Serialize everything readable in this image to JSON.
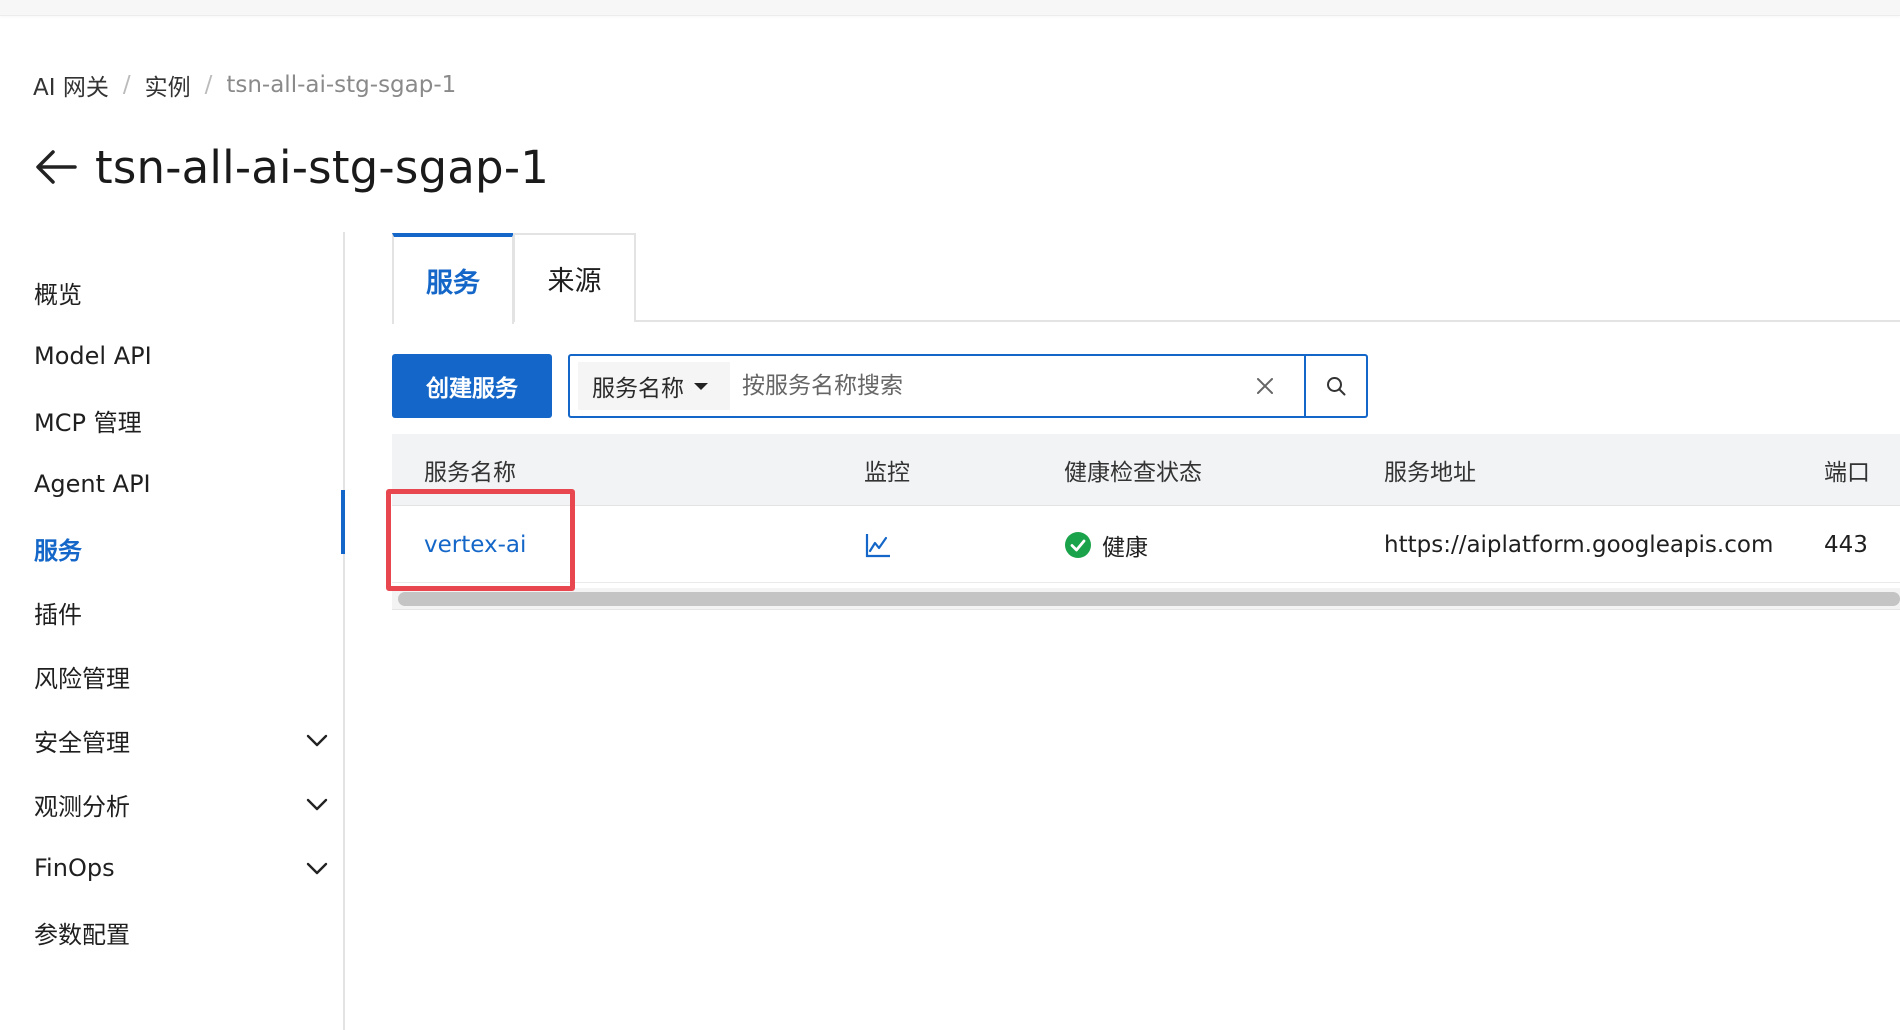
{
  "breadcrumb": [
    "AI 网关",
    "实例",
    "tsn-all-ai-stg-sgap-1"
  ],
  "page_title": "tsn-all-ai-stg-sgap-1",
  "sidebar": {
    "items": [
      {
        "label": "概览"
      },
      {
        "label": "Model API"
      },
      {
        "label": "MCP 管理"
      },
      {
        "label": "Agent API"
      },
      {
        "label": "服务",
        "active": true
      },
      {
        "label": "插件"
      },
      {
        "label": "风险管理"
      },
      {
        "label": "安全管理",
        "expandable": true
      },
      {
        "label": "观测分析",
        "expandable": true
      },
      {
        "label": "FinOps",
        "expandable": true
      },
      {
        "label": "参数配置"
      }
    ]
  },
  "tabs": [
    {
      "label": "服务",
      "active": true
    },
    {
      "label": "来源"
    }
  ],
  "toolbar": {
    "create_label": "创建服务",
    "search_field_label": "服务名称",
    "search_placeholder": "按服务名称搜索"
  },
  "table": {
    "columns": [
      "服务名称",
      "监控",
      "健康检查状态",
      "服务地址",
      "端口"
    ],
    "rows": [
      {
        "name": "vertex-ai",
        "health": "健康",
        "address": "https://aiplatform.googleapis.com",
        "port": "443"
      }
    ]
  },
  "colors": {
    "accent": "#1467c8",
    "health_ok": "#1aa34a",
    "highlight": "#e8474f"
  }
}
